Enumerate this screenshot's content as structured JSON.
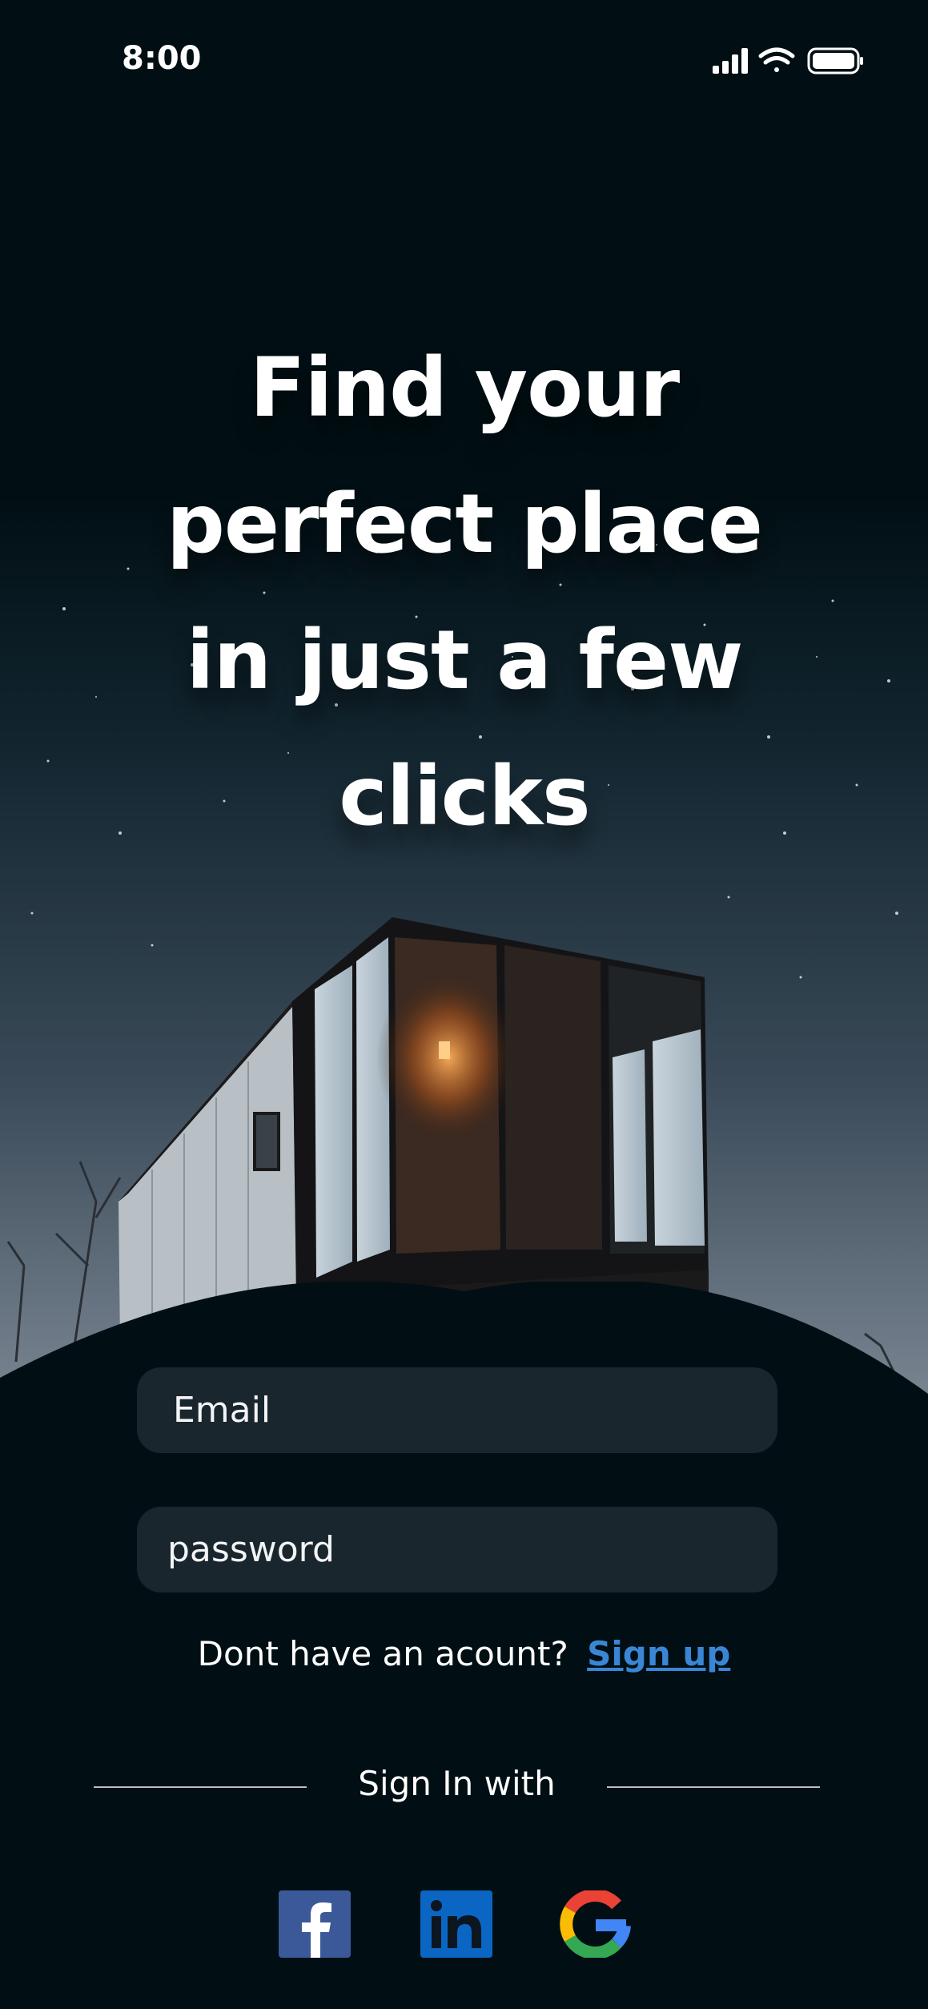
{
  "status_bar": {
    "time": "8:00",
    "icons": [
      "signal-icon",
      "wifi-icon",
      "battery-icon"
    ]
  },
  "hero": {
    "headline_lines": [
      "Find your",
      "perfect place",
      "in just a few",
      "clicks"
    ]
  },
  "form": {
    "email_placeholder": "Email",
    "password_placeholder": "password"
  },
  "signup": {
    "prompt": "Dont have an acount?",
    "link_label": "Sign up"
  },
  "signin_with": "Sign In with",
  "social": [
    "facebook-icon",
    "linkedin-icon",
    "google-icon"
  ],
  "colors": {
    "background": "#010f14",
    "field": "#1a262d",
    "link": "#3a86d4",
    "facebook": "#3b5998",
    "linkedin": "#0a66c2"
  }
}
